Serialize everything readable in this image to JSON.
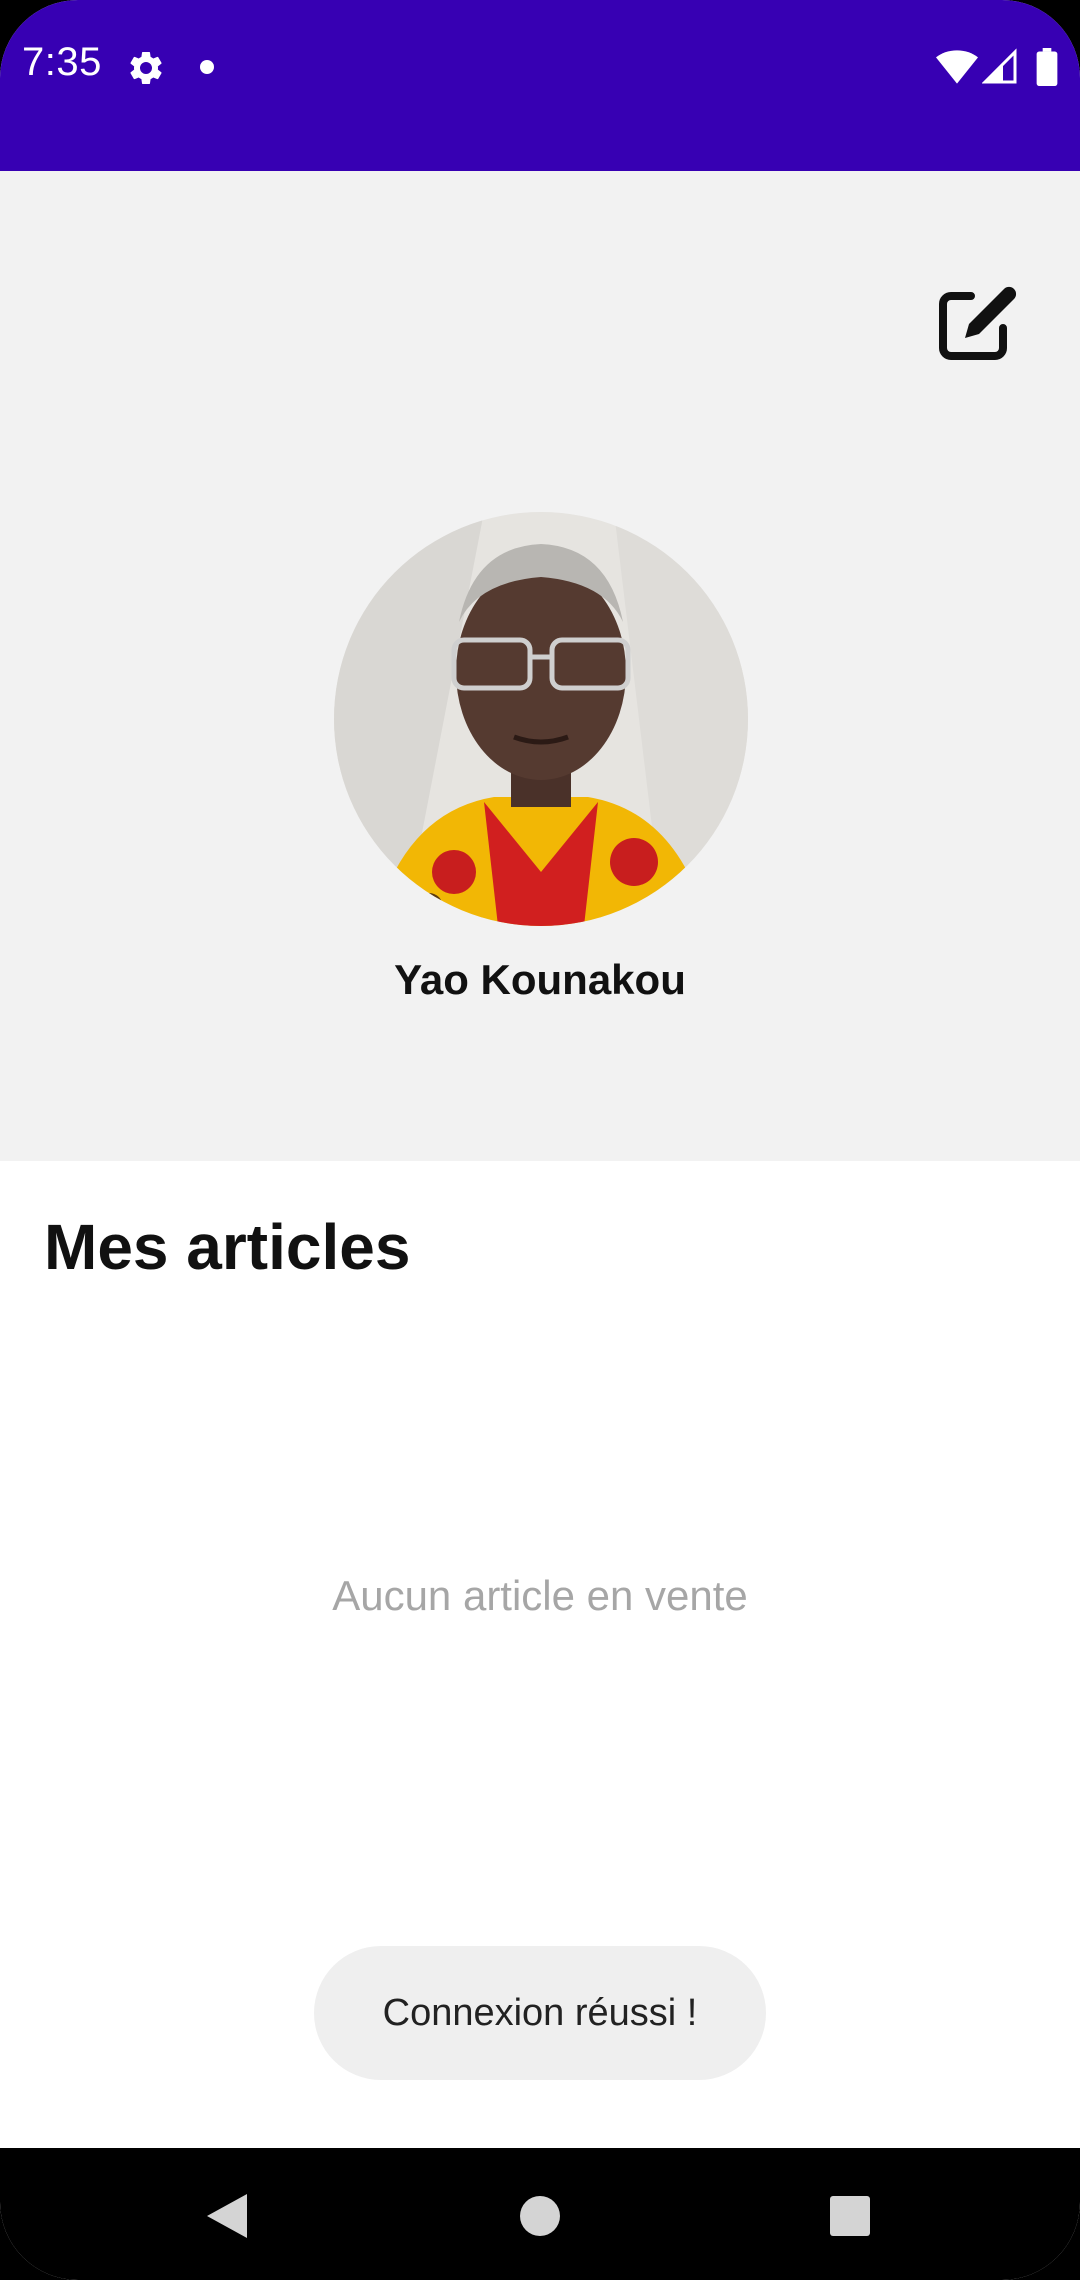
{
  "status_bar": {
    "time": "7:35",
    "icons": [
      "gear-icon",
      "notification-dot-icon",
      "wifi-icon",
      "signal-icon",
      "battery-icon"
    ],
    "background_color": "#3700b3"
  },
  "profile": {
    "edit_icon": "edit-icon",
    "avatar_description": "profile-photo",
    "name": "Yao Kounakou",
    "header_background": "#f2f2f2"
  },
  "articles": {
    "title": "Mes articles",
    "empty_message": "Aucun article en vente"
  },
  "toast": {
    "message": "Connexion réussi !"
  },
  "nav_bar": {
    "icons": [
      "back-icon",
      "home-icon",
      "recents-icon"
    ]
  }
}
